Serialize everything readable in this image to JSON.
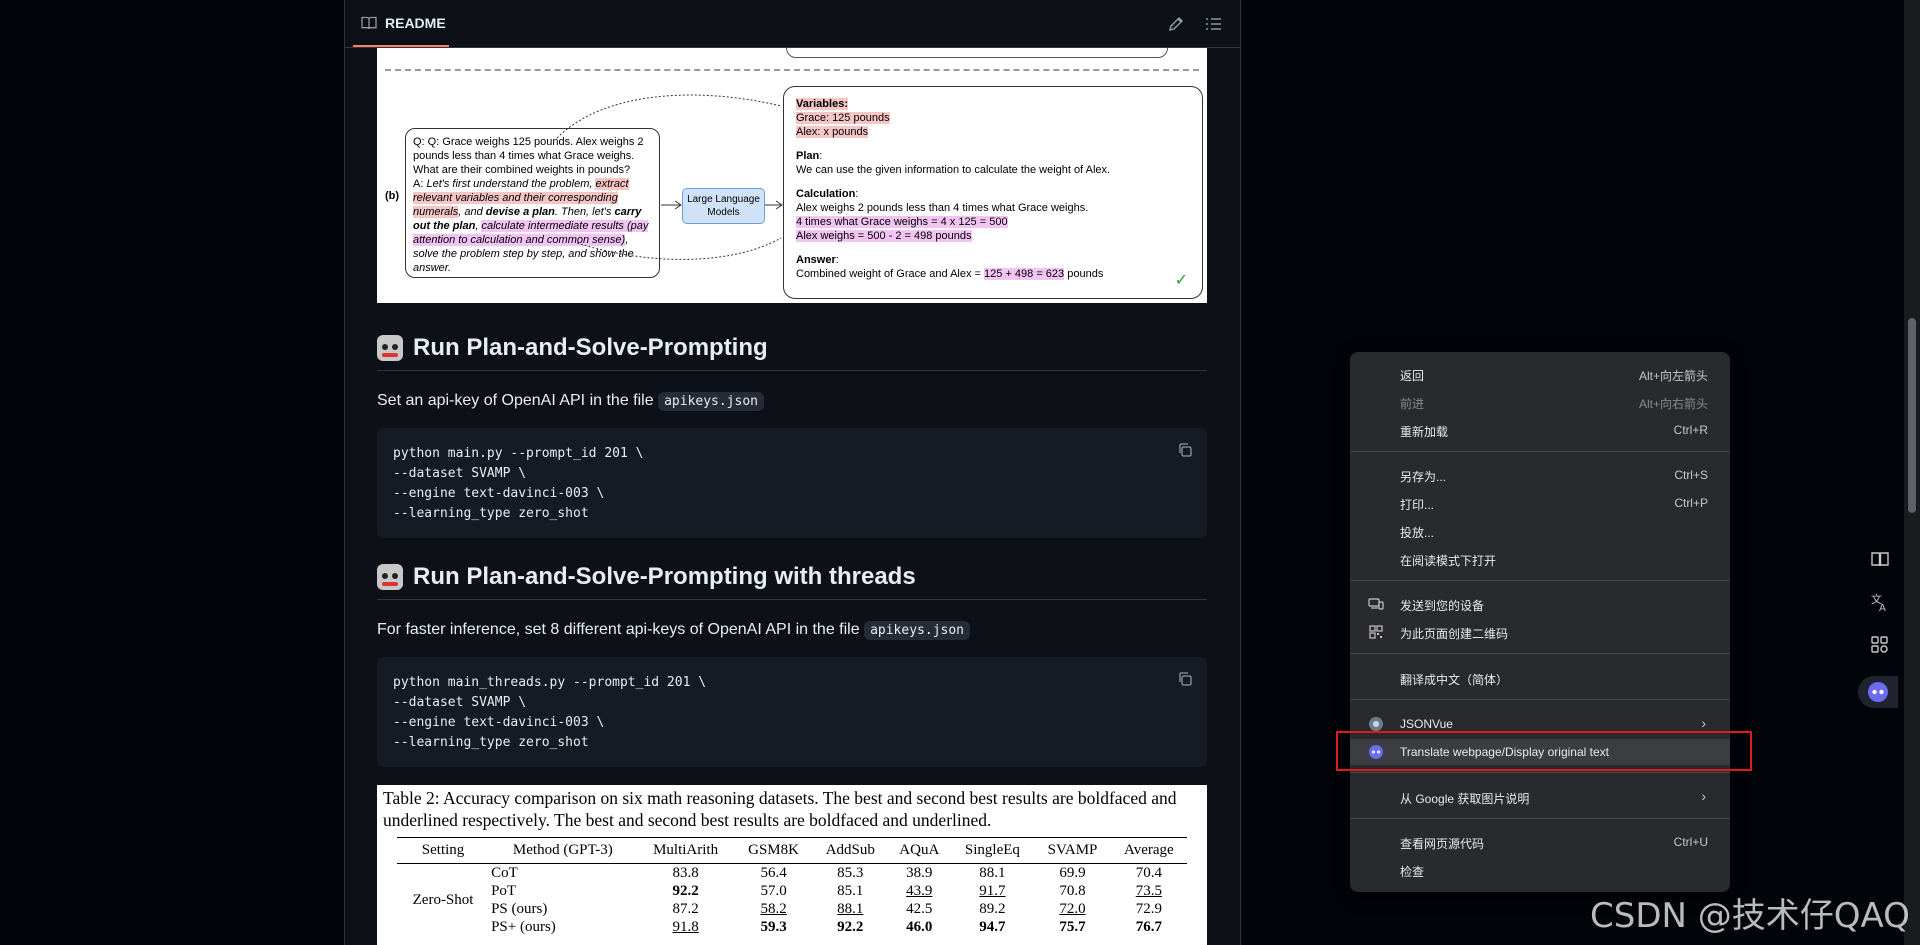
{
  "readme": {
    "tab_label": "README"
  },
  "figure": {
    "label_b": "(b)",
    "question": {
      "l1": "Q: Q: Grace weighs 125 pounds. Alex weighs 2",
      "l2": "pounds less than 4 times what Grace weighs.",
      "l3": "What are their combined weights in pounds?",
      "a_prefix": "A: ",
      "a1": "Let's first understand the problem, ",
      "a2": "extract relevant variables and their corresponding numerals",
      "a3": ", and ",
      "a4": "devise a plan",
      "a5": ". Then, let's ",
      "a6": "carry out the plan",
      "a7": ", ",
      "a8": "calculate intermediate results (pay attention to calculation and common sense)",
      "a9": ", solve the problem step by step, and show the answer."
    },
    "llm_label": "Large Language Models",
    "answer": {
      "variables_title": "Variables:",
      "var1": "Grace: 125 pounds",
      "var2": "Alex: x pounds",
      "plan_title": "Plan",
      "plan_text": "We can use the given information to calculate the weight of Alex.",
      "calc_title": "Calculation",
      "calc1": "Alex weighs 2 pounds less than 4 times what Grace weighs.",
      "calc2": "4 times what Grace weighs = 4 x 125 = 500",
      "calc3": "Alex weighs = 500 - 2 = 498 pounds",
      "answer_title": "Answer",
      "answer_pre": "Combined weight of Grace and Alex = ",
      "answer_hl": "125 + 498 = 623",
      "answer_post": " pounds"
    }
  },
  "section1": {
    "title": "Run Plan-and-Solve-Prompting",
    "text": "Set an api-key of OpenAI API in the file ",
    "file": "apikeys.json",
    "code": "python main.py --prompt_id 201 \\\n--dataset SVAMP \\\n--engine text-davinci-003 \\\n--learning_type zero_shot"
  },
  "section2": {
    "title": "Run Plan-and-Solve-Prompting with threads",
    "text": "For faster inference, set 8 different api-keys of OpenAI API in the file ",
    "file": "apikeys.json",
    "code": "python main_threads.py --prompt_id 201 \\\n--dataset SVAMP \\\n--engine text-davinci-003 \\\n--learning_type zero_shot"
  },
  "table": {
    "caption": "Table 2: Accuracy comparison on six math reasoning datasets. The best and second best results are boldfaced and underlined respectively. The best and second best results are boldfaced and underlined.",
    "headers": [
      "Setting",
      "Method (GPT-3)",
      "MultiArith",
      "GSM8K",
      "AddSub",
      "AQuA",
      "SingleEq",
      "SVAMP",
      "Average"
    ],
    "setting": "Zero-Shot",
    "rows": [
      {
        "method": "CoT",
        "v": [
          "83.8",
          "56.4",
          "85.3",
          "38.9",
          "88.1",
          "69.9",
          "70.4"
        ]
      },
      {
        "method": "PoT",
        "v": [
          "92.2",
          "57.0",
          "85.1",
          "43.9",
          "91.7",
          "70.8",
          "73.5"
        ]
      },
      {
        "method": "PS (ours)",
        "v": [
          "87.2",
          "58.2",
          "88.1",
          "42.5",
          "89.2",
          "72.0",
          "72.9"
        ]
      },
      {
        "method": "PS+ (ours)",
        "v": [
          "91.8",
          "59.3",
          "92.2",
          "46.0",
          "94.7",
          "75.7",
          "76.7"
        ]
      }
    ]
  },
  "context_menu": {
    "back": "返回",
    "back_key": "Alt+向左箭头",
    "forward": "前进",
    "forward_key": "Alt+向右箭头",
    "reload": "重新加载",
    "reload_key": "Ctrl+R",
    "save_as": "另存为...",
    "save_as_key": "Ctrl+S",
    "print": "打印...",
    "print_key": "Ctrl+P",
    "cast": "投放...",
    "reader_mode": "在阅读模式下打开",
    "send_to_device": "发送到您的设备",
    "qr_code": "为此页面创建二维码",
    "translate_cn": "翻译成中文（简体）",
    "jsonvue": "JSONVue",
    "translate_webpage": "Translate webpage/Display original text",
    "google_image": "从 Google 获取图片说明",
    "view_source": "查看网页源代码",
    "view_source_key": "Ctrl+U",
    "inspect": "检查"
  },
  "watermark": "CSDN @技术仔QAQ"
}
